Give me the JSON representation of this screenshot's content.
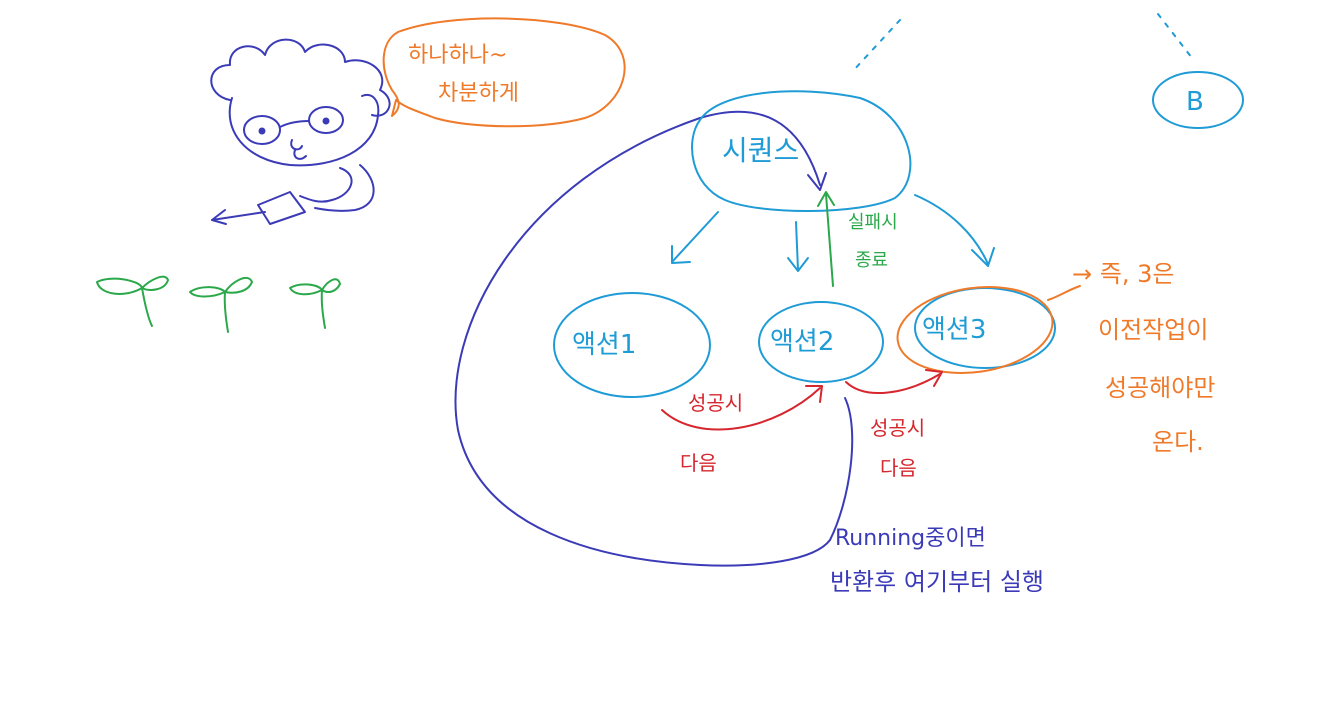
{
  "colors": {
    "blue": "#1f9bd6",
    "navy": "#3b3bb8",
    "orange": "#ef7a2a",
    "red": "#d6262e",
    "green": "#2aa84a"
  },
  "speech_bubble": {
    "line1": "하나하나~",
    "line2": "차분하게"
  },
  "nodes": {
    "sequence": "시퀀스",
    "action1": "액션1",
    "action2": "액션2",
    "action3": "액션3",
    "b": "B"
  },
  "labels": {
    "fail_1": "실패시",
    "fail_2": "종료",
    "success_a_1": "성공시",
    "success_a_2": "다음",
    "success_b_1": "성공시",
    "success_b_2": "다음",
    "note_1": "→ 즉, 3은",
    "note_2": "이전작업이",
    "note_3": "성공해야만",
    "note_4": "온다.",
    "running_1": "Running중이면",
    "running_2": "반환후 여기부터 실행"
  }
}
